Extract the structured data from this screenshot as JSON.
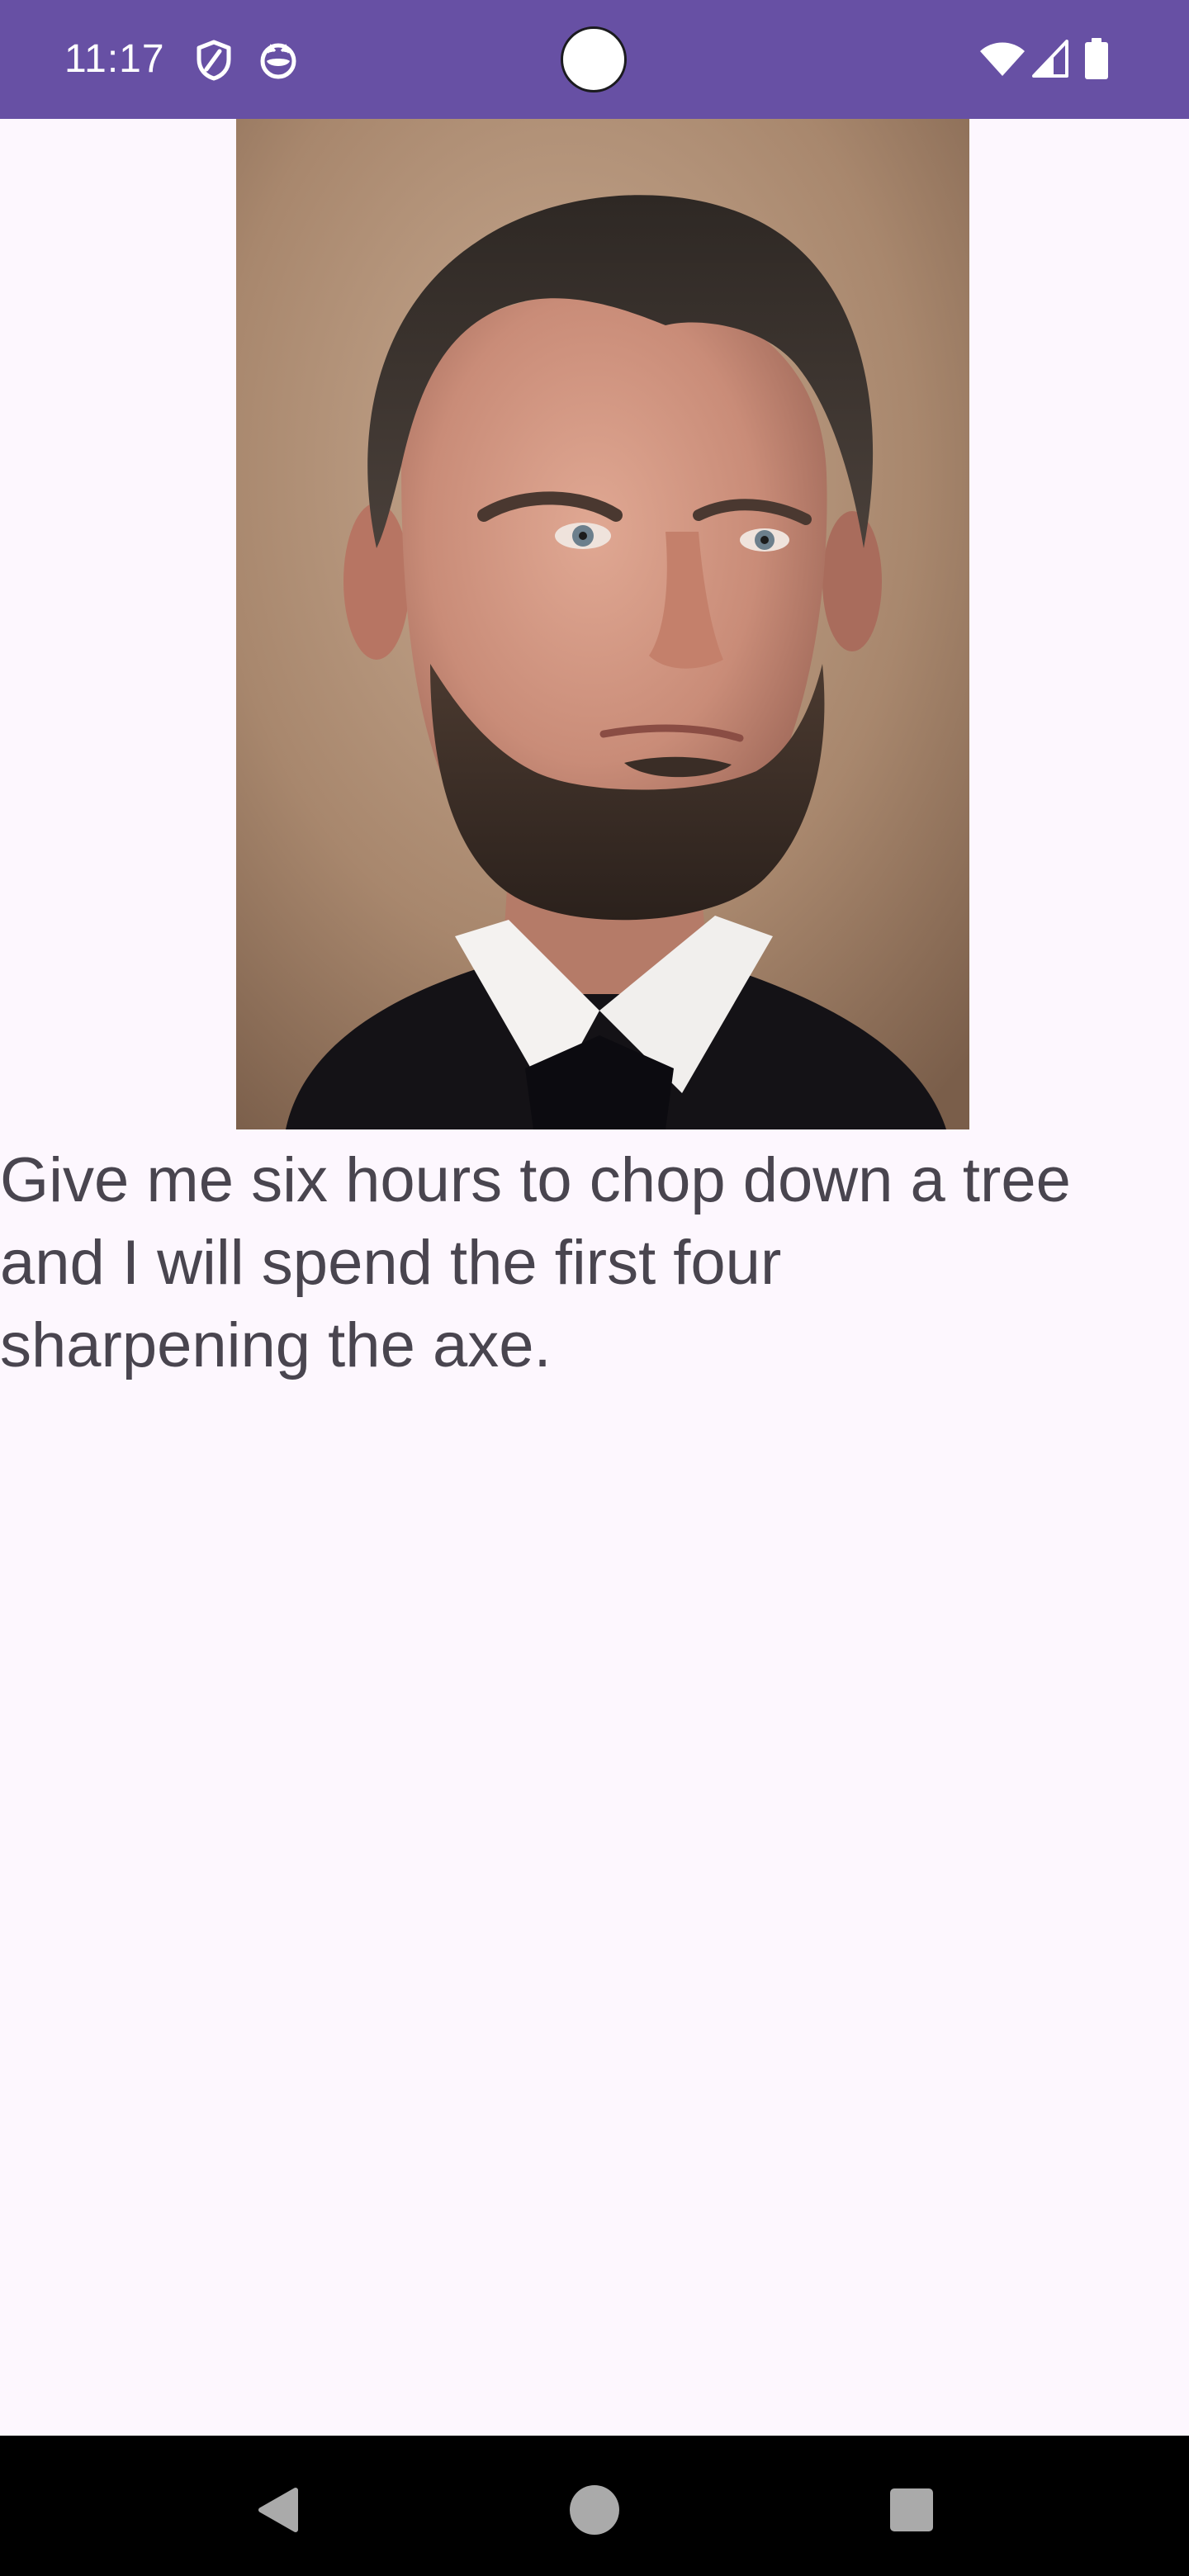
{
  "status_bar": {
    "time": "11:17",
    "background_color": "#6750a4",
    "left_icons": [
      "shield-icon",
      "cat-face-icon"
    ],
    "right_icons": [
      "wifi-icon",
      "cellular-signal-icon",
      "battery-icon"
    ]
  },
  "content": {
    "image_subject": "portrait-photo",
    "quote": "Give me six hours to chop down a tree and I will spend the first four sharpening the axe."
  },
  "navigation_bar": {
    "buttons": [
      "back-icon",
      "home-icon",
      "recents-icon"
    ]
  },
  "colors": {
    "background": "#fdf7fe",
    "text": "#49454f",
    "status_bar": "#6750a4",
    "nav_bar": "#000000"
  }
}
